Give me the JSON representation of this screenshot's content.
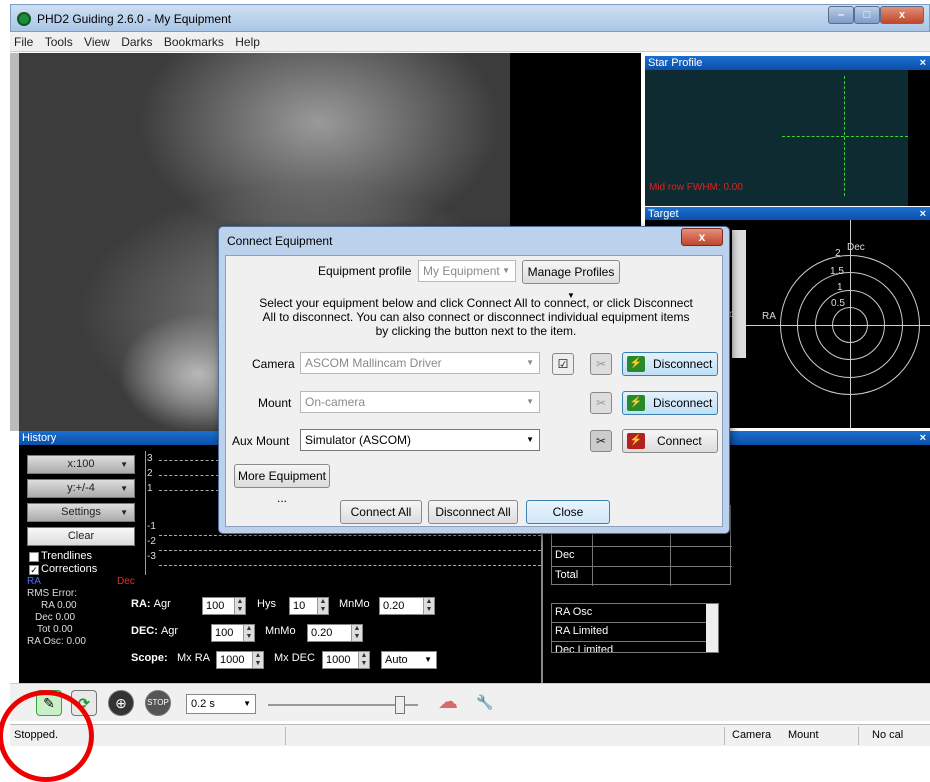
{
  "window": {
    "title": "PHD2 Guiding 2.6.0 - My Equipment"
  },
  "menu": [
    "File",
    "Tools",
    "View",
    "Darks",
    "Bookmarks",
    "Help"
  ],
  "star_profile": {
    "title": "Star Profile",
    "fwhm": "Mid row FWHM: 0.00"
  },
  "target": {
    "title": "Target",
    "labels": [
      "2",
      "1.5",
      "1",
      "0.5"
    ],
    "dec": "Dec",
    "ra": "RA",
    "partial": "cle"
  },
  "history": {
    "title": "History",
    "x_scale": "x:100",
    "y_scale": "y:+/-4",
    "settings": "Settings",
    "clear": "Clear",
    "trendlines": "Trendlines",
    "corrections": "Corrections",
    "ra_legend": "RA",
    "dec_legend": "Dec",
    "rms_error": "RMS Error:",
    "ra_val": "RA 0.00",
    "dec_val": "Dec 0.00",
    "tot_val": "Tot 0.00",
    "ra_osc": "RA Osc: 0.00",
    "y_ticks": [
      "3",
      "2",
      "1",
      "-1",
      "-2",
      "-3"
    ]
  },
  "controls": {
    "ra_label": "RA:",
    "ra_agr_label": "Agr",
    "ra_agr": "100",
    "ra_hys_label": "Hys",
    "ra_hys": "10",
    "ra_mnmo_label": "MnMo",
    "ra_mnmo": "0.20",
    "dec_label": "DEC:",
    "dec_agr_label": "Agr",
    "dec_agr": "100",
    "dec_mnmo_label": "MnMo",
    "dec_mnmo": "0.20",
    "scope_label": "Scope:",
    "mx_ra_label": "Mx RA",
    "mx_ra": "1000",
    "mx_dec_label": "Mx DEC",
    "mx_dec": "1000",
    "mode": "Auto"
  },
  "stats": {
    "rows": [
      "Dec",
      "Total"
    ],
    "osc_rows": [
      "RA Osc",
      "RA Limited",
      "Dec Limited"
    ]
  },
  "toolbar": {
    "exposure": "0.2 s"
  },
  "status": {
    "text": "Stopped.",
    "camera": "Camera",
    "mount": "Mount",
    "cal": "No cal"
  },
  "dialog": {
    "title": "Connect Equipment",
    "close_x": "x",
    "profile_label": "Equipment profile",
    "profile_value": "My Equipment",
    "manage_profiles": "Manage Profiles",
    "instructions": "Select your equipment below and click Connect All to connect, or click Disconnect All to disconnect. You can also connect or disconnect individual equipment items by clicking the button next to the item.",
    "camera_label": "Camera",
    "camera_value": "ASCOM Mallincam Driver",
    "camera_btn": "Disconnect",
    "mount_label": "Mount",
    "mount_value": "On-camera",
    "mount_btn": "Disconnect",
    "aux_label": "Aux Mount",
    "aux_value": "Simulator (ASCOM)",
    "aux_btn": "Connect",
    "more_equipment": "More Equipment ...",
    "connect_all": "Connect All",
    "disconnect_all": "Disconnect All",
    "close": "Close"
  }
}
